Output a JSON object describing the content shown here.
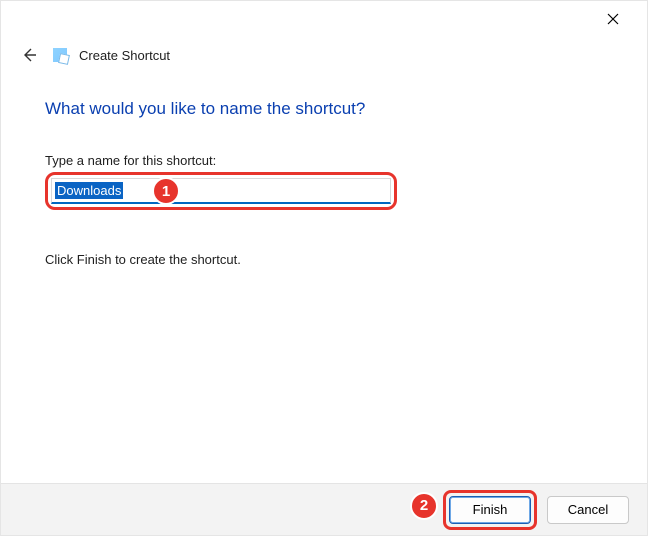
{
  "window": {
    "title": "Create Shortcut"
  },
  "main": {
    "heading": "What would you like to name the shortcut?",
    "label": "Type a name for this shortcut:",
    "input_value": "Downloads",
    "hint": "Click Finish to create the shortcut."
  },
  "footer": {
    "finish": "Finish",
    "cancel": "Cancel"
  },
  "annotations": {
    "badge1": "1",
    "badge2": "2"
  }
}
